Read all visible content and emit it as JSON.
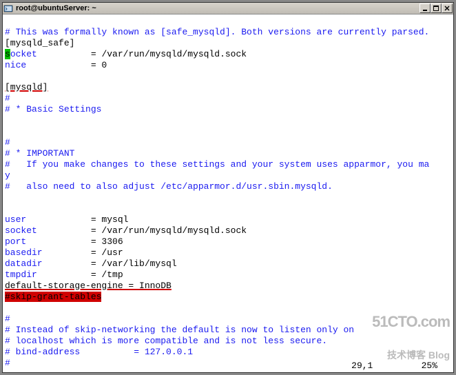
{
  "window": {
    "title": "root@ubuntuServer: ~",
    "icon_name": "terminal-icon"
  },
  "content": {
    "l1": "# This was formally known as [safe_mysqld]. Both versions are currently parsed.",
    "l2a": "[mysqld_safe]",
    "l3a_cursor": "s",
    "l3a": "ocket",
    "l3b": "          = /var/run/mysqld/mysqld.sock",
    "l4a": "nice",
    "l4b": "            = 0",
    "l5": "",
    "l6": "[mysqld]",
    "l7": "#",
    "l8": "# * Basic Settings",
    "l9": "",
    "l10": "",
    "l11": "#",
    "l12": "# * IMPORTANT",
    "l13": "#   If you make changes to these settings and your system uses apparmor, you ma",
    "l13wrap": "y",
    "l14": "#   also need to also adjust /etc/apparmor.d/usr.sbin.mysqld.",
    "l15": "",
    "l16": "",
    "l17a": "user",
    "l17b": "            = mysql",
    "l18a": "socket",
    "l18b": "          = /var/run/mysqld/mysqld.sock",
    "l19a": "port",
    "l19b": "            = 3306",
    "l20a": "basedir",
    "l20b": "         = /usr",
    "l21a": "datadir",
    "l21b": "         = /var/lib/mysql",
    "l22a": "tmpdir",
    "l22b": "          = /tmp",
    "l23": "default-storage-engine = InnoDB",
    "l24": "#skip-grant-tables",
    "l25": "",
    "l26": "#",
    "l27": "# Instead of skip-networking the default is now to listen only on",
    "l28": "# localhost which is more compatible and is not less secure.",
    "l29": "# bind-address          = 127.0.0.1",
    "l30": "#"
  },
  "status": {
    "position": "29,1",
    "percent": "25%"
  },
  "watermark": {
    "line1": "51CTO.com",
    "line2": "技术博客 Blog"
  }
}
